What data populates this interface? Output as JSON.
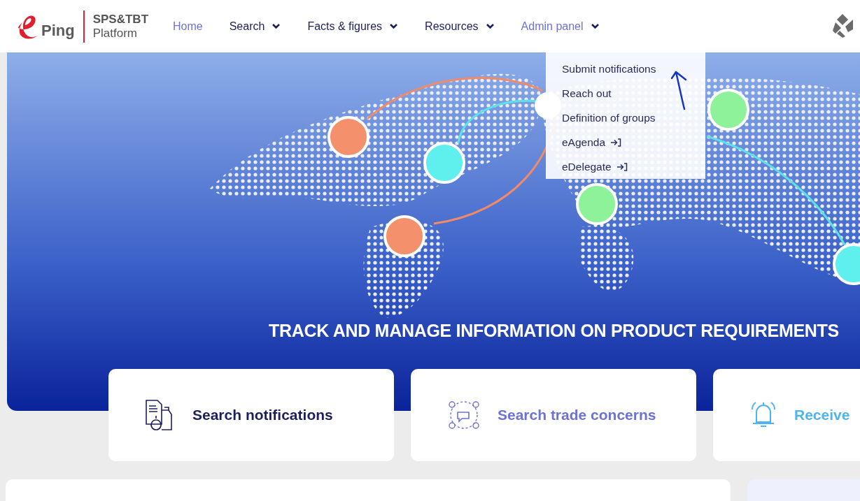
{
  "logo": {
    "brand": "Ping",
    "line_1": "SPS&TBT",
    "line_2": "Platform"
  },
  "nav": [
    {
      "label": "Home",
      "kind": "link",
      "highlighted": true
    },
    {
      "label": "Search",
      "kind": "menu",
      "highlighted": false
    },
    {
      "label": "Facts & figures",
      "kind": "menu",
      "highlighted": false
    },
    {
      "label": "Resources",
      "kind": "menu",
      "highlighted": false
    },
    {
      "label": "Admin panel",
      "kind": "menu",
      "highlighted": true
    }
  ],
  "dropdown": [
    {
      "label": "Submit notifications",
      "kind": "internal"
    },
    {
      "label": "Reach out",
      "kind": "internal"
    },
    {
      "label": "Definition of groups",
      "kind": "internal"
    },
    {
      "label": "eAgenda",
      "kind": "external"
    },
    {
      "label": "eDelegate",
      "kind": "external"
    }
  ],
  "hero": {
    "title": "TRACK AND MANAGE INFORMATION ON PRODUCT REQUIREMENTS"
  },
  "cards": [
    {
      "label": "Search notifications",
      "kind": "notifications",
      "color": "#1c1f5e"
    },
    {
      "label": "Search trade concerns",
      "kind": "concerns",
      "color": "#6c72d6"
    },
    {
      "label": "Receive",
      "kind": "alerts",
      "color": "#4cb4f0"
    }
  ]
}
